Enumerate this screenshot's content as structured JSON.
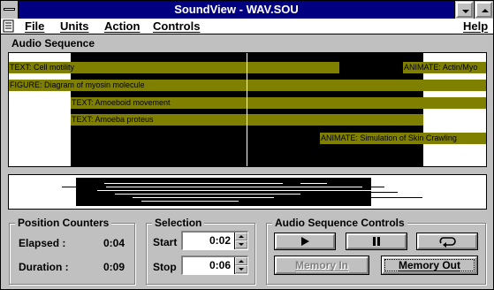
{
  "window": {
    "title": "SoundView - WAV.SOU"
  },
  "menubar": {
    "items": [
      {
        "label": "File"
      },
      {
        "label": "Units"
      },
      {
        "label": "Action"
      },
      {
        "label": "Controls"
      },
      {
        "label": "Help"
      }
    ]
  },
  "sequence": {
    "label": "Audio Sequence",
    "tracks": [
      {
        "text": "TEXT: Cell motility"
      },
      {
        "text": "ANIMATE: Actin/Myo"
      },
      {
        "text": "FIGURE: Diagram of myosin molecule"
      },
      {
        "text": "TEXT: Amoeboid movement"
      },
      {
        "text": "TEXT: Amoeba proteus"
      },
      {
        "text": "ANIMATE: Simulation of Skin Crawling"
      }
    ]
  },
  "position": {
    "title": "Position Counters",
    "elapsed_label": "Elapsed :",
    "elapsed_value": "0:04",
    "duration_label": "Duration :",
    "duration_value": "0:09"
  },
  "selection": {
    "title": "Selection",
    "start_label": "Start",
    "start_value": "0:02",
    "stop_label": "Stop",
    "stop_value": "0:06"
  },
  "controls": {
    "title": "Audio Sequence Controls",
    "play_icon": "play-icon",
    "pause_icon": "pause-icon",
    "loop_icon": "loop-icon",
    "memory_in_label": "Memory In",
    "memory_out_label": "Memory Out"
  },
  "colors": {
    "title_bar": "#000080",
    "face": "#c0c0c0",
    "track": "#808000"
  }
}
